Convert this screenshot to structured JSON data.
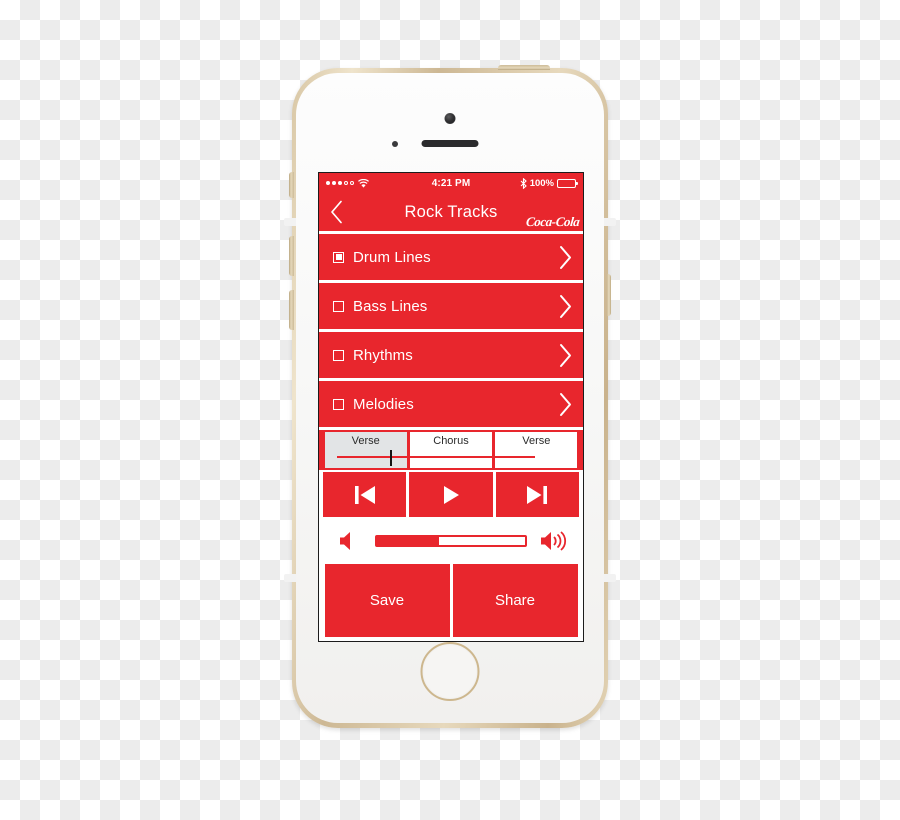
{
  "device": {
    "name": "iphone-gold-white",
    "body_color": "#d8c6a4",
    "face_color": "#f7f7f6"
  },
  "screen": {
    "accent_color": "#E8262D",
    "status_bar": {
      "signal_dots_filled": 3,
      "signal_dots_total": 5,
      "wifi_icon": "wifi-icon",
      "time": "4:21 PM",
      "bluetooth_icon": "bluetooth-icon",
      "battery_percent": "100%",
      "battery_fill": 100
    },
    "nav_bar": {
      "back_icon": "chevron-left-icon",
      "title": "Rock Tracks",
      "brand": "Coca-Cola",
      "brand_logo_icon": "coca-cola-logo"
    },
    "tracks": [
      {
        "label": "Drum Lines",
        "checked": true,
        "chevron_icon": "chevron-right-icon"
      },
      {
        "label": "Bass Lines",
        "checked": false,
        "chevron_icon": "chevron-right-icon"
      },
      {
        "label": "Rhythms",
        "checked": false,
        "chevron_icon": "chevron-right-icon"
      },
      {
        "label": "Melodies",
        "checked": false,
        "chevron_icon": "chevron-right-icon"
      }
    ],
    "timeline": {
      "segments": [
        {
          "label": "Verse",
          "active": true
        },
        {
          "label": "Chorus",
          "active": false
        },
        {
          "label": "Verse",
          "active": false
        }
      ],
      "playhead_position_percent": 27,
      "progress_color": "#E8262D",
      "playhead_color": "#151515"
    },
    "transport": [
      {
        "name": "previous-track-button",
        "icon": "skip-back-icon"
      },
      {
        "name": "play-button",
        "icon": "play-icon"
      },
      {
        "name": "next-track-button",
        "icon": "skip-forward-icon"
      }
    ],
    "volume": {
      "min_icon": "volume-low-icon",
      "max_icon": "volume-high-icon",
      "level_percent": 42
    },
    "actions": [
      {
        "label": "Save"
      },
      {
        "label": "Share"
      }
    ]
  }
}
